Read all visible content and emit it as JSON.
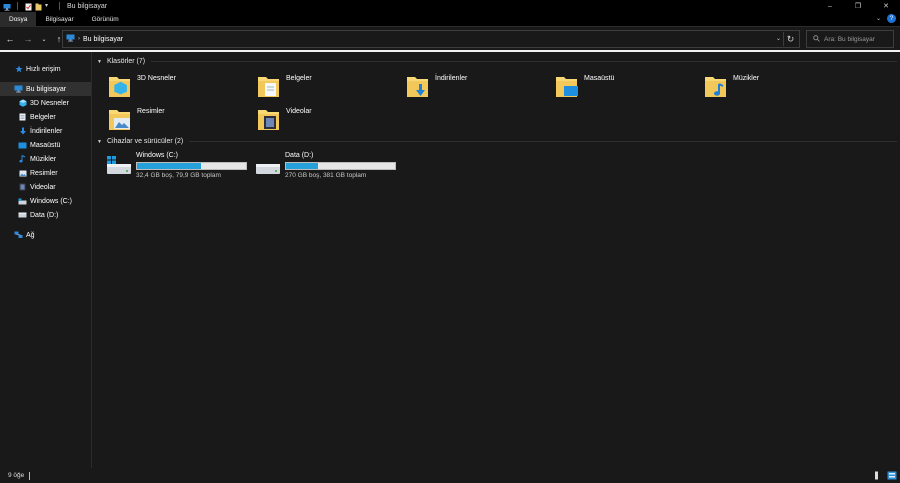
{
  "window": {
    "title": "Bu bilgisayar",
    "minimize": "–",
    "maximize": "❐",
    "close": "✕"
  },
  "ribbon": {
    "tabs": [
      {
        "label": "Dosya",
        "active": true
      },
      {
        "label": "Bilgisayar",
        "active": false
      },
      {
        "label": "Görünüm",
        "active": false
      }
    ],
    "expand_glyph": "⌄",
    "help_glyph": "?"
  },
  "nav": {
    "back": "←",
    "forward": "→",
    "recent": "⌄",
    "up": "↑",
    "breadcrumb_sep": "›",
    "breadcrumb": "Bu bilgisayar",
    "dropdown": "⌄",
    "refresh": "↻"
  },
  "search": {
    "icon": "search-icon",
    "placeholder": "Ara: Bu bilgisayar"
  },
  "sidebar": {
    "items": [
      {
        "label": "Hızlı erişim",
        "icon": "star-icon",
        "level": 0
      },
      {
        "label": "Bu bilgisayar",
        "icon": "computer-icon",
        "level": 0,
        "selected": true
      },
      {
        "label": "3D Nesneler",
        "icon": "cube-icon",
        "level": 1
      },
      {
        "label": "Belgeler",
        "icon": "document-icon",
        "level": 1
      },
      {
        "label": "İndirilenler",
        "icon": "download-icon",
        "level": 1
      },
      {
        "label": "Masaüstü",
        "icon": "desktop-icon",
        "level": 1
      },
      {
        "label": "Müzikler",
        "icon": "music-icon",
        "level": 1
      },
      {
        "label": "Resimler",
        "icon": "picture-icon",
        "level": 1
      },
      {
        "label": "Videolar",
        "icon": "video-icon",
        "level": 1
      },
      {
        "label": "Windows (C:)",
        "icon": "windows-drive-icon",
        "level": 1
      },
      {
        "label": "Data (D:)",
        "icon": "drive-icon",
        "level": 1
      },
      {
        "label": "Ağ",
        "icon": "network-icon",
        "level": 0
      }
    ]
  },
  "folders_group": {
    "header": "Klasörler (7)",
    "items": [
      {
        "label": "3D Nesneler",
        "icon": "folder-3d-icon"
      },
      {
        "label": "Belgeler",
        "icon": "folder-documents-icon"
      },
      {
        "label": "İndirilenler",
        "icon": "folder-downloads-icon"
      },
      {
        "label": "Masaüstü",
        "icon": "folder-desktop-icon"
      },
      {
        "label": "Müzikler",
        "icon": "folder-music-icon"
      },
      {
        "label": "Resimler",
        "icon": "folder-pictures-icon"
      },
      {
        "label": "Videolar",
        "icon": "folder-videos-icon"
      }
    ]
  },
  "drives_group": {
    "header": "Cihazlar ve sürücüler (2)",
    "items": [
      {
        "name": "Windows (C:)",
        "size_text": "32,4 GB boş, 79,9 GB toplam",
        "used_fraction": 0.59,
        "icon": "windows-drive-icon"
      },
      {
        "name": "Data (D:)",
        "size_text": "270 GB boş, 381 GB toplam",
        "used_fraction": 0.29,
        "icon": "drive-icon"
      }
    ]
  },
  "status": {
    "item_count": "9 öğe"
  },
  "colors": {
    "background": "#191919",
    "drive_fill": "#26a0da",
    "folder_yellow": "#f8d775",
    "accent_blue": "#1e74d6"
  }
}
